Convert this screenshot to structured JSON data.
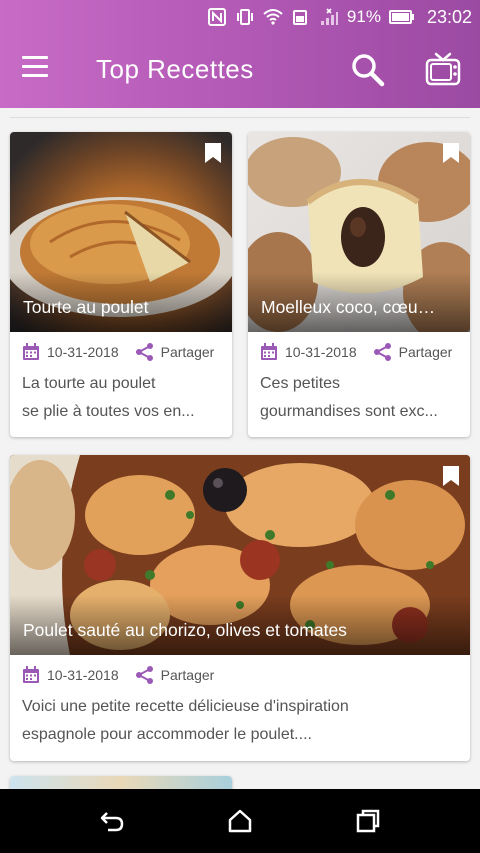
{
  "status_bar": {
    "battery": "91%",
    "time": "23:02"
  },
  "app_bar": {
    "title": "Top Recettes"
  },
  "colors": {
    "brand_gradient_start": "#c76bc6",
    "brand_gradient_end": "#9b4aa2",
    "accent": "#9b59b6"
  },
  "recipes": [
    {
      "title": "Tourte au poulet",
      "date": "10-31-2018",
      "share_label": "Partager",
      "description_line1": "La tourte au poulet",
      "description_line2": "se plie à toutes vos en..."
    },
    {
      "title": "Moelleux coco, cœur ...",
      "date": "10-31-2018",
      "share_label": "Partager",
      "description_line1": "Ces petites",
      "description_line2": "gourmandises sont exc..."
    },
    {
      "title": "Poulet sauté au chorizo, olives et tomates",
      "date": "10-31-2018",
      "share_label": "Partager",
      "description_line1": "Voici une petite recette délicieuse d'inspiration",
      "description_line2": "espagnole pour accommoder le poulet...."
    }
  ],
  "icons": {
    "menu": "menu-icon",
    "search": "search-icon",
    "tv": "tv-icon",
    "bookmark": "bookmark-icon",
    "calendar": "calendar-icon",
    "share": "share-icon",
    "back": "back-icon",
    "home": "home-icon",
    "recents": "recents-icon"
  }
}
